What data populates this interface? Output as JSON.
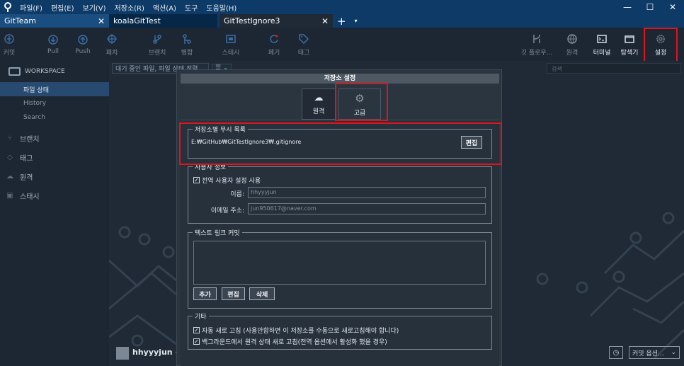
{
  "colors": {
    "accent": "#0d3a66",
    "highlight": "#e0141b",
    "sidebar_active": "#284a70"
  },
  "menubar": {
    "items": [
      "파일(F)",
      "편집(E)",
      "보기(V)",
      "저장소(R)",
      "액션(A)",
      "도구",
      "도움말(H)"
    ],
    "controls": {
      "minimize": "—",
      "maximize": "☐",
      "close": "✕"
    }
  },
  "tabs": [
    {
      "label": "GitTeam",
      "close": "✕"
    },
    {
      "label": "koalaGitTest"
    },
    {
      "label": "GitTestIgnore3",
      "close": "✕"
    }
  ],
  "tabbar": {
    "plus": "+",
    "dropdown": "▾"
  },
  "toolbar": {
    "commit": "커밋",
    "pull": "Pull",
    "push": "Push",
    "patch": "패치",
    "branch": "브랜치",
    "merge": "병합",
    "stash": "스태시",
    "discard": "폐기",
    "tag": "태그",
    "git_flow": "깃 플로우...",
    "remote": "원격",
    "terminal": "터미널",
    "explorer": "탐색기",
    "settings": "설정"
  },
  "sidebar": {
    "workspace": "WORKSPACE",
    "workspace_items": [
      "파일 상태",
      "History",
      "Search"
    ],
    "branches": "브랜치",
    "tags": "태그",
    "remotes": "원격",
    "stashes": "스태시"
  },
  "content": {
    "filter_text": "대기 중인 파일, 파일 상태 정렬 ⌄",
    "filter_view": "☰ ⌄",
    "search_placeholder": "검색",
    "author": "hhyyyjun <j",
    "commit_options": "커밋 옵션...",
    "commit_options_caret": "⌄"
  },
  "dialog": {
    "title": "저장소 설정",
    "tab_remote": "원격",
    "tab_advanced": "고급",
    "ignore_section": {
      "legend": "저장소별 무시 목록",
      "path": "E:₩GitHub₩GitTestIgnore3₩.gitignore",
      "edit_button": "편집"
    },
    "user_section": {
      "legend": "사용자 정보",
      "use_global": "전역 사용자 설정 사용",
      "name_label": "이름:",
      "name_value": "hhyyyjun",
      "email_label": "이메일 주소:",
      "email_value": "jun950617@naver.com"
    },
    "link_section": {
      "legend": "텍스트 링크 커밋",
      "add": "추가",
      "edit": "편집",
      "delete": "삭제"
    },
    "other_section": {
      "legend": "기타",
      "auto_refresh": "자동 새로 고침 (사용안함하면 이 저장소를 수동으로 새로고침해야 합니다)",
      "bg_refresh": "백그라운드에서 원격 상태 새로 고침(전역 옵션에서 활성화 했을 경우)"
    }
  }
}
